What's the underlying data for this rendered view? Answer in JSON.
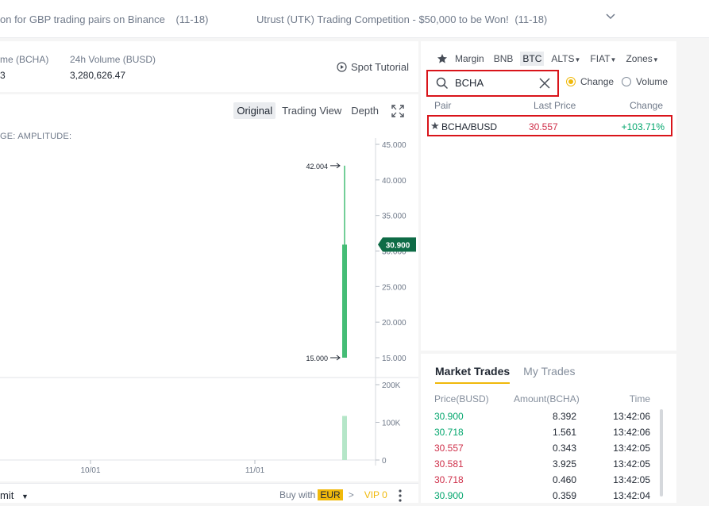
{
  "announcements": {
    "item1": "on for GBP trading pairs on Binance",
    "item1_date": "(11-18)",
    "item2": "Utrust (UTK) Trading Competition - $50,000 to be Won!",
    "item2_date": "(11-18)"
  },
  "stats": {
    "vol_label": "me (BCHA)",
    "vol_value": "3",
    "vol2_label": "24h Volume (BUSD)",
    "vol2_value": "3,280,626.47",
    "spot_tutorial": "Spot Tutorial"
  },
  "chart": {
    "tabs": [
      "Original",
      "Trading View",
      "Depth"
    ],
    "active_tab": "Original",
    "amplitude_label": "GE:   AMPLITUDE:",
    "current_price_tag": "30.900"
  },
  "chart_data": {
    "type": "candlestick",
    "price_axis": [
      "45.000",
      "40.000",
      "35.000",
      "30.000",
      "25.000",
      "20.000",
      "15.000"
    ],
    "price_range": [
      15,
      45
    ],
    "volume_axis": [
      "200K",
      "100K",
      "0"
    ],
    "volume_range": [
      0,
      200000
    ],
    "x_labels": [
      "10/01",
      "11/01"
    ],
    "candle": {
      "open": 15.0,
      "close": 30.9,
      "high": 42.004,
      "low": 15.0
    },
    "volume_bar": 117000,
    "high_label": "42.004",
    "low_label": "15.000"
  },
  "bottom": {
    "order_type": "mit",
    "buy_with": "Buy with",
    "currency": "EUR",
    "vip": "VIP 0"
  },
  "markets": {
    "tabs": [
      {
        "label": "Margin",
        "active": false
      },
      {
        "label": "BNB",
        "active": false
      },
      {
        "label": "BTC",
        "active": true
      },
      {
        "label": "ALTS",
        "active": false,
        "dropdown": true
      },
      {
        "label": "FIAT",
        "active": false,
        "dropdown": true
      },
      {
        "label": "Zones",
        "active": false,
        "dropdown": true
      }
    ],
    "search_value": "BCHA",
    "radio_change": "Change",
    "radio_volume": "Volume",
    "col_pair": "Pair",
    "col_last_price": "Last Price",
    "col_change": "Change",
    "rows": [
      {
        "pair": "BCHA/BUSD",
        "last_price": "30.557",
        "change": "+103.71%"
      }
    ]
  },
  "trades": {
    "tab_market": "Market Trades",
    "tab_my": "My Trades",
    "col_price": "Price(BUSD)",
    "col_amount": "Amount(BCHA)",
    "col_time": "Time",
    "rows": [
      {
        "price": "30.900",
        "amount": "8.392",
        "time": "13:42:06",
        "side": "buy"
      },
      {
        "price": "30.718",
        "amount": "1.561",
        "time": "13:42:06",
        "side": "buy"
      },
      {
        "price": "30.557",
        "amount": "0.343",
        "time": "13:42:05",
        "side": "sell"
      },
      {
        "price": "30.581",
        "amount": "3.925",
        "time": "13:42:05",
        "side": "sell"
      },
      {
        "price": "30.718",
        "amount": "0.460",
        "time": "13:42:05",
        "side": "sell"
      },
      {
        "price": "30.900",
        "amount": "0.359",
        "time": "13:42:04",
        "side": "buy"
      }
    ]
  },
  "colors": {
    "up": "#03a66d",
    "down": "#cf304a",
    "accent": "#f0b90b",
    "highlight": "#d9141a"
  }
}
